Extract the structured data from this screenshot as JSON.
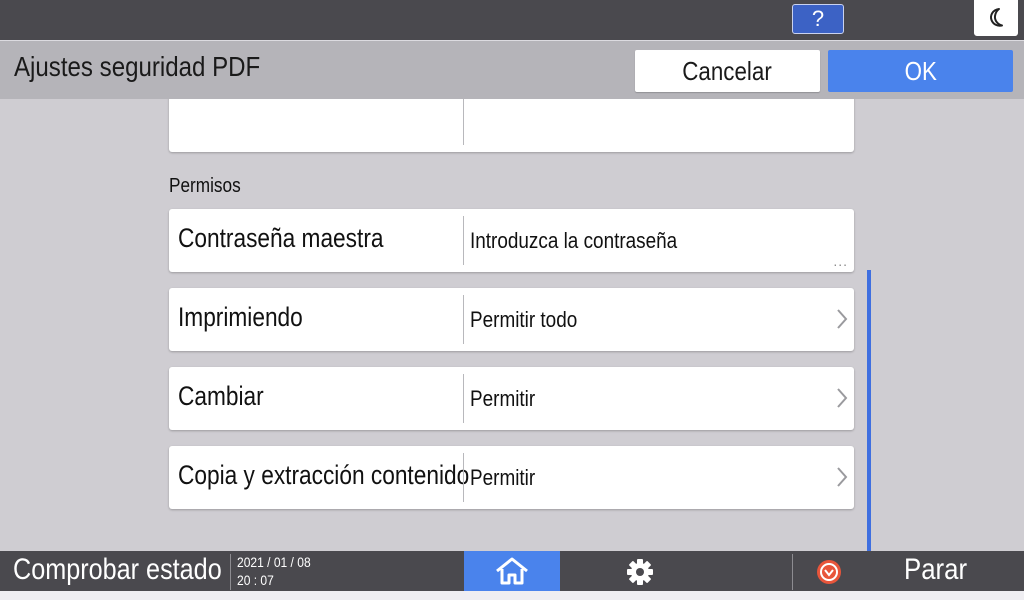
{
  "topbar": {
    "help_label": "?"
  },
  "header": {
    "title": "Ajustes seguridad PDF",
    "cancel_label": "Cancelar",
    "ok_label": "OK"
  },
  "section": {
    "label": "Permisos"
  },
  "rows": [
    {
      "label": "Contraseña maestra",
      "value": "Introduzca la contraseña",
      "indicator": "..."
    },
    {
      "label": "Imprimiendo",
      "value": "Permitir todo"
    },
    {
      "label": "Cambiar",
      "value": "Permitir"
    },
    {
      "label": "Copia y extracción contenido",
      "value": "Permitir"
    }
  ],
  "bottombar": {
    "status_label": "Comprobar estado",
    "date": "2021 / 01 / 08",
    "time": "20 : 07",
    "stop_label": "Parar"
  },
  "colors": {
    "accent": "#4a83ec",
    "bar": "#4a494e",
    "header": "#b5b4b9",
    "background": "#cfcdd2",
    "stop": "#e8553b"
  },
  "icons": {
    "help": "help-icon",
    "moon": "moon-icon",
    "chevron": "chevron-right-icon",
    "home": "home-icon",
    "gear": "gear-icon",
    "stop": "stop-icon"
  }
}
